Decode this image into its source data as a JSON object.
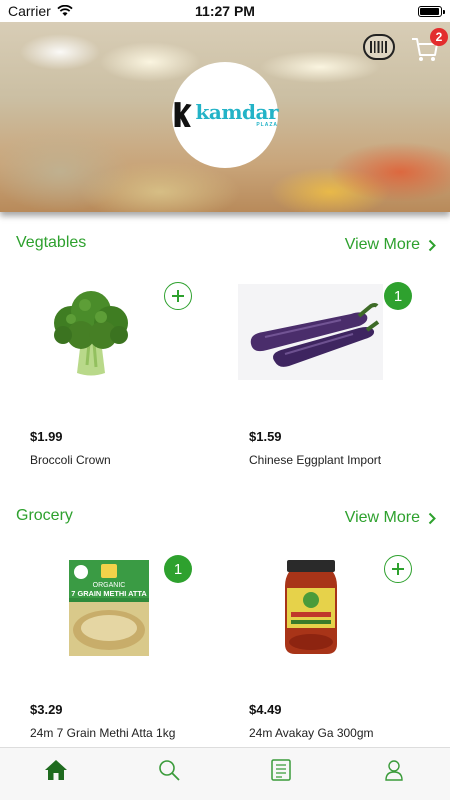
{
  "status_bar": {
    "carrier": "Carrier",
    "time": "11:27 PM",
    "battery_level": 0.95
  },
  "header": {
    "logo_word": "kamdar",
    "logo_sub": "PLAZA",
    "cart_count": "2",
    "icons": [
      "barcode-scanner-icon",
      "cart-icon"
    ]
  },
  "sections": [
    {
      "title": "Vegtables",
      "view_more": "View More",
      "products": [
        {
          "price": "$1.99",
          "name": "Broccoli Crown",
          "in_cart": false,
          "image": "broccoli"
        },
        {
          "price": "$1.59",
          "name": "Chinese Eggplant Import",
          "in_cart": true,
          "quantity": "1",
          "image": "eggplant"
        }
      ]
    },
    {
      "title": "Grocery",
      "view_more": "View More",
      "products": [
        {
          "price": "$3.29",
          "name": "24m 7 Grain Methi Atta 1kg",
          "in_cart": true,
          "quantity": "1",
          "image": "atta-bag",
          "package_text": {
            "line1": "ORGANIC",
            "line2": "7 GRAIN METHI ATTA"
          }
        },
        {
          "price": "$4.49",
          "name": "24m Avakay Ga 300gm",
          "in_cart": false,
          "image": "pickle-jar"
        }
      ]
    }
  ],
  "tab_bar": {
    "tabs": [
      "home-icon",
      "search-icon",
      "orders-icon",
      "profile-icon"
    ],
    "active": "home-icon"
  },
  "colors": {
    "accent": "#2ea12e",
    "badge": "#e32d2d",
    "logo": "#23b3c7"
  }
}
